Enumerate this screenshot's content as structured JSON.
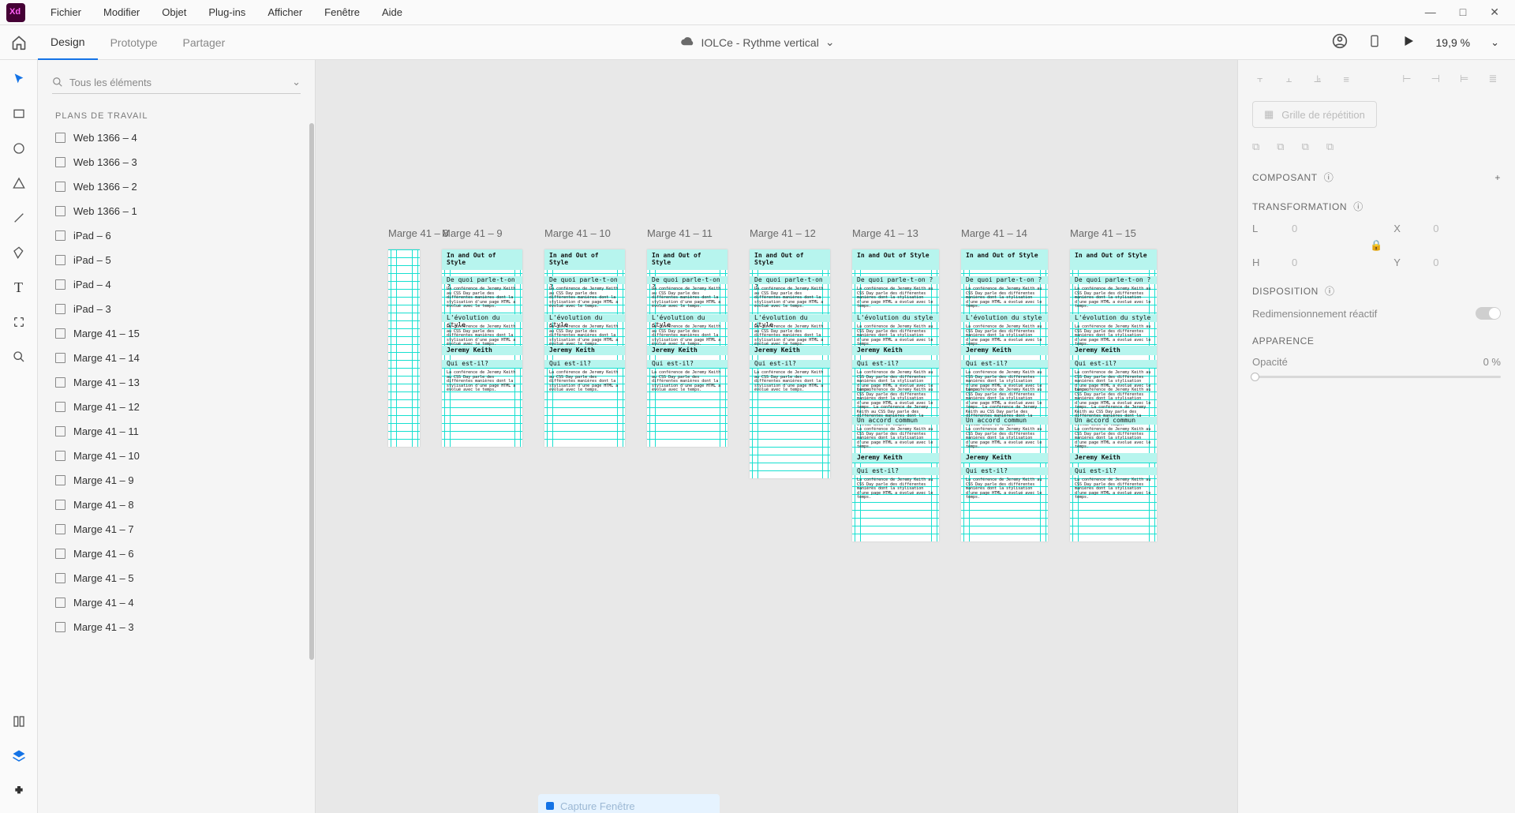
{
  "menu": {
    "items": [
      "Fichier",
      "Modifier",
      "Objet",
      "Plug-ins",
      "Afficher",
      "Fenêtre",
      "Aide"
    ]
  },
  "modes": {
    "design": "Design",
    "prototype": "Prototype",
    "share": "Partager"
  },
  "doc": {
    "title": "IOLCe - Rythme vertical"
  },
  "zoom": "19,9 %",
  "search_placeholder": "Tous les éléments",
  "layers_header": "PLANS DE TRAVAIL",
  "layers": [
    "Web 1366 – 4",
    "Web 1366 – 3",
    "Web 1366 – 2",
    "Web 1366 – 1",
    "iPad – 6",
    "iPad – 5",
    "iPad – 4",
    "iPad – 3",
    "Marge 41 – 15",
    "Marge 41 – 14",
    "Marge 41 – 13",
    "Marge 41 – 12",
    "Marge 41 – 11",
    "Marge 41 – 10",
    "Marge 41 – 9",
    "Marge 41 – 8",
    "Marge 41 – 7",
    "Marge 41 – 6",
    "Marge 41 – 5",
    "Marge 41 – 4",
    "Marge 41 – 3"
  ],
  "artboards": [
    "Marge 41 – 8",
    "Marge 41 – 9",
    "Marge 41 – 10",
    "Marge 41 – 11",
    "Marge 41 – 12",
    "Marge 41 – 13",
    "Marge 41 – 14",
    "Marge 41 – 15"
  ],
  "artcontent": {
    "h1": "In and Out of Style",
    "q": "De quoi parle-t-on ?",
    "p": "La conférence de Jeremy Keith au CSS Day parle des différentes manières dont la stylisation d'une page HTML a évolué avec le temps.",
    "h2a": "L'évolution du style",
    "author": "Jeremy Keith",
    "h2b": "Qui est-il?",
    "h2c": "Un accord commun"
  },
  "props": {
    "repeat": "Grille de répétition",
    "component": "COMPOSANT",
    "transform": "TRANSFORMATION",
    "L": "L",
    "Lval": "0",
    "X": "X",
    "Xval": "0",
    "H": "H",
    "Hval": "0",
    "Y": "Y",
    "Yval": "0",
    "disposition": "DISPOSITION",
    "responsive": "Redimensionnement réactif",
    "appearance": "APPARENCE",
    "opacity": "Opacité",
    "opval": "0 %"
  },
  "capture": "Capture Fenêtre"
}
